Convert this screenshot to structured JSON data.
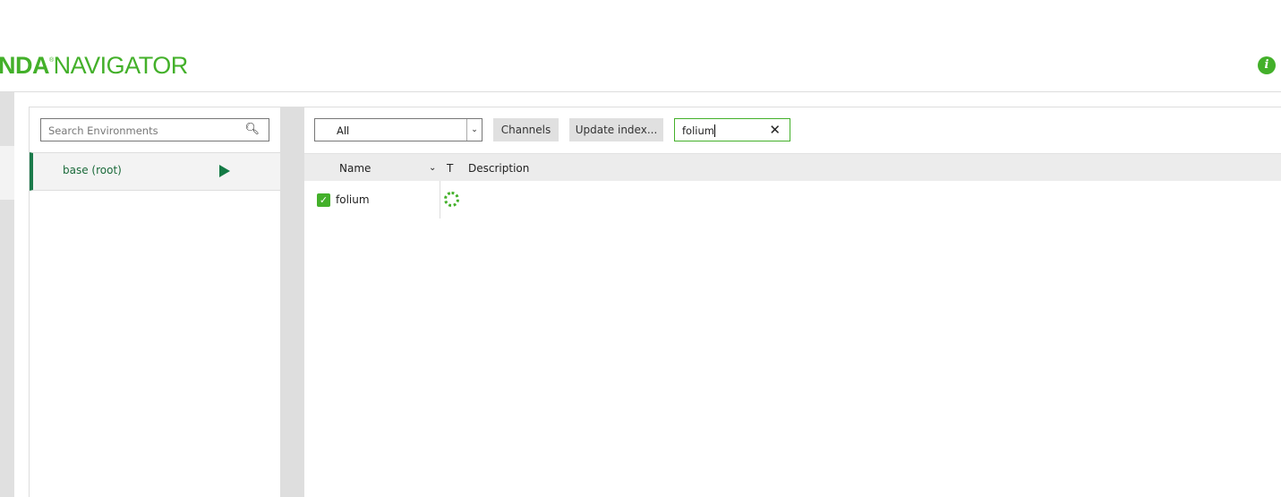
{
  "header": {
    "logo_bold": "NDA",
    "logo_light": "NAVIGATOR",
    "logo_mark": "®",
    "info_icon": "info-icon"
  },
  "environments": {
    "search_placeholder": "Search Environments",
    "items": [
      {
        "label": "base (root)",
        "active": true
      }
    ]
  },
  "packages": {
    "filter_selected": "All",
    "channels_label": "Channels",
    "update_index_label": "Update index...",
    "search_value": "folium",
    "columns": [
      "Name",
      "T",
      "Description"
    ],
    "rows": [
      {
        "name": "folium",
        "checked": true,
        "status": "loading",
        "description": ""
      }
    ]
  },
  "colors": {
    "accent": "#43b02a",
    "env_active": "#1a7a4a"
  }
}
